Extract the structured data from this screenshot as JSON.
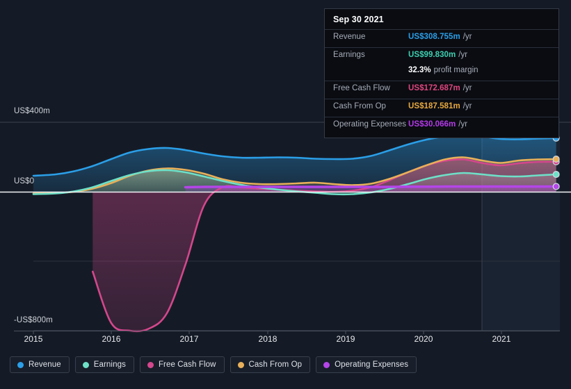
{
  "axes": {
    "y_labels": [
      {
        "text": "US$400m",
        "value": 400
      },
      {
        "text": "US$0",
        "value": 0
      },
      {
        "text": "-US$800m",
        "value": -800
      }
    ],
    "x_labels": [
      "2015",
      "2016",
      "2017",
      "2018",
      "2019",
      "2020",
      "2021"
    ],
    "y_min": -800,
    "y_max": 400,
    "currency": "US$",
    "unit": "m"
  },
  "tooltip": {
    "date": "Sep 30 2021",
    "rows": [
      {
        "label": "Revenue",
        "value": "US$308.755m",
        "unit": "/yr",
        "color": "#2b9fe8"
      },
      {
        "label": "Earnings",
        "value": "US$99.830m",
        "unit": "/yr",
        "color": "#3ecfb0"
      },
      {
        "label": "Free Cash Flow",
        "value": "US$172.687m",
        "unit": "/yr",
        "color": "#e0457f"
      },
      {
        "label": "Cash From Op",
        "value": "US$187.581m",
        "unit": "/yr",
        "color": "#e8a93f"
      },
      {
        "label": "Operating Expenses",
        "value": "US$30.066m",
        "unit": "/yr",
        "color": "#b43ae8"
      }
    ],
    "profit_margin_value": "32.3%",
    "profit_margin_label": "profit margin"
  },
  "legend": {
    "items": [
      {
        "label": "Revenue",
        "color": "#2b9fe8"
      },
      {
        "label": "Earnings",
        "color": "#6ee0c8"
      },
      {
        "label": "Free Cash Flow",
        "color": "#d4478c"
      },
      {
        "label": "Cash From Op",
        "color": "#e8b05a"
      },
      {
        "label": "Operating Expenses",
        "color": "#b445e8"
      }
    ]
  },
  "chart_data": {
    "type": "area",
    "title": "",
    "xlabel": "",
    "ylabel": "US$ millions",
    "xlim": [
      2014.7,
      2021.8
    ],
    "ylim": [
      -800,
      400
    ],
    "grid": true,
    "legend_position": "bottom",
    "forecast_split_x": 2020.75,
    "x": [
      2014.7,
      2015.0,
      2015.25,
      2015.5,
      2015.75,
      2016.0,
      2016.25,
      2016.5,
      2016.75,
      2017.0,
      2017.25,
      2017.5,
      2017.75,
      2018.0,
      2018.25,
      2018.5,
      2018.75,
      2019.0,
      2019.25,
      2019.5,
      2019.75,
      2020.0,
      2020.25,
      2020.5,
      2020.75,
      2021.0,
      2021.25,
      2021.5,
      2021.75
    ],
    "series": [
      {
        "name": "Revenue",
        "color": "#2b9fe8",
        "values": [
          92,
          100,
          118,
          148,
          188,
          226,
          246,
          252,
          240,
          220,
          204,
          196,
          196,
          198,
          196,
          190,
          188,
          190,
          206,
          238,
          272,
          300,
          318,
          326,
          318,
          304,
          302,
          306,
          308.755
        ]
      },
      {
        "name": "Earnings",
        "color": "#6ee0c8",
        "values": [
          -14,
          -10,
          2,
          26,
          62,
          96,
          118,
          124,
          112,
          88,
          62,
          40,
          24,
          12,
          2,
          -6,
          -14,
          -14,
          -4,
          16,
          44,
          74,
          96,
          108,
          100,
          90,
          88,
          94,
          99.83
        ]
      },
      {
        "name": "Free Cash Flow",
        "color": "#d4478c",
        "values": [
          null,
          null,
          null,
          -460,
          -756,
          -800,
          -790,
          -700,
          -420,
          -80,
          26,
          24,
          18,
          12,
          6,
          2,
          0,
          6,
          26,
          66,
          112,
          152,
          178,
          186,
          166,
          152,
          164,
          172,
          172.687
        ]
      },
      {
        "name": "Cash From Op",
        "color": "#e8b05a",
        "values": [
          -10,
          -8,
          0,
          18,
          50,
          92,
          122,
          134,
          126,
          104,
          72,
          52,
          44,
          44,
          48,
          52,
          44,
          38,
          46,
          74,
          112,
          152,
          186,
          198,
          180,
          166,
          180,
          186,
          187.581
        ]
      },
      {
        "name": "Operating Expenses",
        "color": "#b445e8",
        "values": [
          null,
          null,
          null,
          null,
          null,
          null,
          null,
          null,
          26,
          28,
          28,
          28,
          28,
          28,
          28,
          28,
          28,
          28,
          28,
          28,
          29,
          29,
          30,
          30,
          30,
          30,
          30,
          30,
          30.066
        ]
      }
    ]
  }
}
